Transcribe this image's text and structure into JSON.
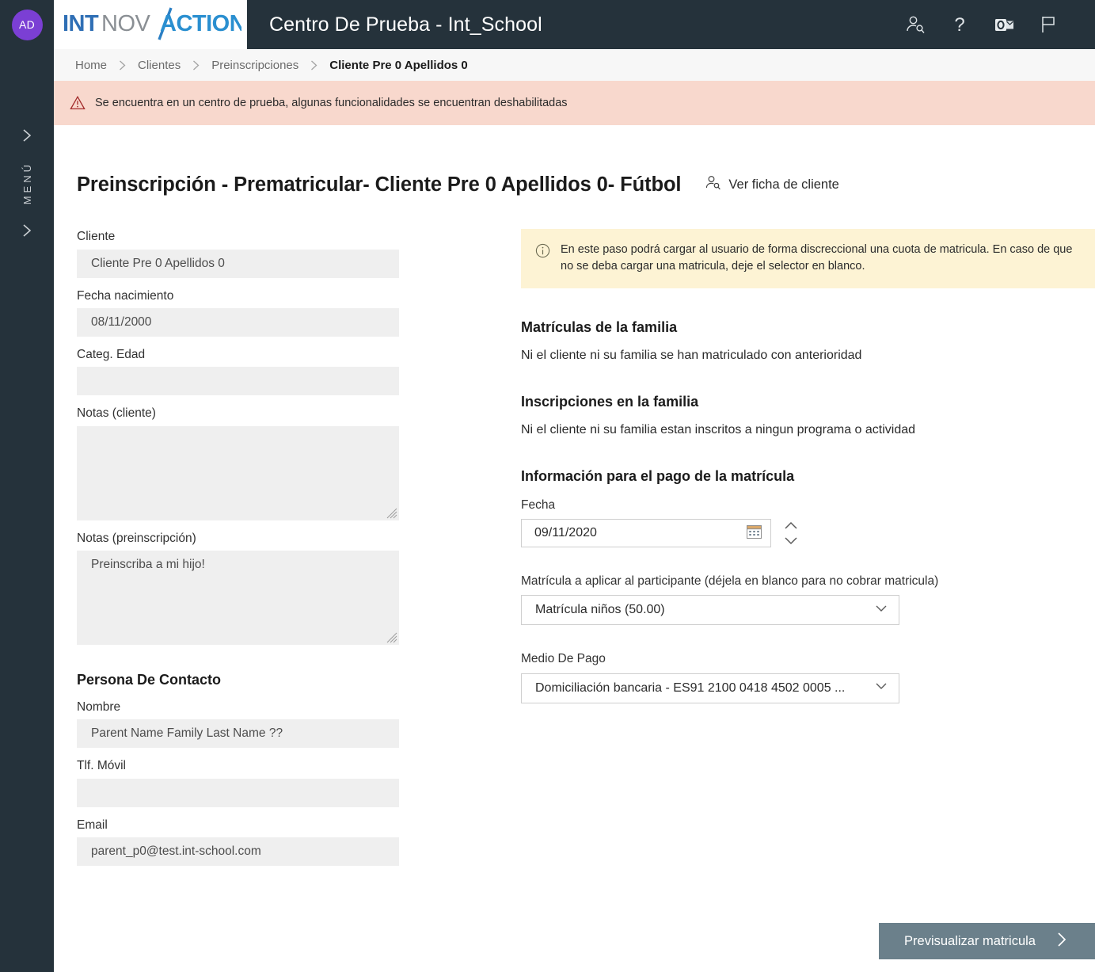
{
  "rail": {
    "avatar_initials": "AD",
    "menu_label": "MENÚ",
    "expand_icon": "chevron-right-icon",
    "collapse_icon": "chevron-right-icon"
  },
  "topbar": {
    "logo_part1": "INT",
    "logo_part2": "NOV",
    "logo_part3": "ACTION",
    "app_title": "Centro De Prueba - Int_School",
    "icons": [
      {
        "name": "person-search-icon",
        "label": "Buscar usuario"
      },
      {
        "name": "help-question-icon",
        "label": "Ayuda"
      },
      {
        "name": "outlook-mail-icon",
        "label": "Outlook"
      },
      {
        "name": "flag-icon",
        "label": "Avisos"
      }
    ],
    "colors": {
      "bar_background": "#25323b",
      "logo_blue": "#2a8fd0",
      "logo_dark_blue": "#2f6fb5",
      "logo_gray": "#8a8f94",
      "avatar_purple": "#7b3fd4"
    }
  },
  "breadcrumb": {
    "separator": "›",
    "items": [
      {
        "label": "Home",
        "current": false
      },
      {
        "label": "Clientes",
        "current": false
      },
      {
        "label": "Preinscripciones",
        "current": false
      },
      {
        "label": "Cliente Pre 0 Apellidos 0",
        "current": true
      }
    ]
  },
  "alert": {
    "icon": "warning-triangle-icon",
    "text": "Se encuentra en un centro de prueba, algunas funcionalidades se encuentran deshabilitadas",
    "background": "#f8d8cd",
    "icon_color": "#a32b2b"
  },
  "page": {
    "title": "Preinscripción - Prematricular- Cliente Pre 0 Apellidos 0- Fútbol",
    "ficha_link": "Ver ficha de cliente",
    "ficha_icon": "person-search-icon"
  },
  "left_form": {
    "fields": [
      {
        "label": "Cliente",
        "value": "Cliente Pre 0 Apellidos 0",
        "type": "readonly-input"
      },
      {
        "label": "Fecha nacimiento",
        "value": "08/11/2000",
        "type": "readonly-input"
      },
      {
        "label": "Categ. Edad",
        "value": "",
        "type": "readonly-input"
      },
      {
        "label": "Notas (cliente)",
        "value": "",
        "type": "readonly-textarea"
      },
      {
        "label": "Notas (preinscripción)",
        "value": "Preinscriba a mi hijo!",
        "type": "readonly-textarea"
      }
    ],
    "contact_section": {
      "heading": "Persona De Contacto",
      "fields": [
        {
          "label": "Nombre",
          "value": "Parent Name Family Last Name ??"
        },
        {
          "label": "Tlf. Móvil",
          "value": ""
        },
        {
          "label": "Email",
          "value": "parent_p0@test.int-school.com"
        }
      ]
    }
  },
  "right_panel": {
    "info_box": {
      "icon": "info-circle-icon",
      "text": "En este paso podrá cargar al usuario de forma discreccional una cuota de matricula. En caso de que no se deba cargar una matricula, deje el selector en blanco.",
      "background": "#fdf3d4"
    },
    "sections": [
      {
        "heading": "Matrículas de la familia",
        "text": "Ni el cliente ni su familia se han matriculado con anterioridad"
      },
      {
        "heading": "Inscripciones en la familia",
        "text": "Ni el cliente ni su familia estan inscritos a ningun programa o actividad"
      }
    ],
    "payment": {
      "heading": "Información para el pago de la matrícula",
      "date_label": "Fecha",
      "date_value": "09/11/2020",
      "date_icon": "calendar-icon",
      "spinner_up_icon": "chevron-up-icon",
      "spinner_down_icon": "chevron-down-icon",
      "matricula_label": "Matrícula a aplicar al participante (déjela en blanco para no cobrar matricula)",
      "matricula_value": "Matrícula niños (50.00)",
      "medio_label": "Medio De Pago",
      "medio_value": "Domiciliación bancaria - ES91 2100 0418 4502 0005 ...",
      "dropdown_icon": "chevron-down-icon"
    }
  },
  "footer": {
    "primary_button": "Previsualizar matricula",
    "primary_button_icon": "chevron-right-icon",
    "primary_button_color": "#6b808b"
  }
}
